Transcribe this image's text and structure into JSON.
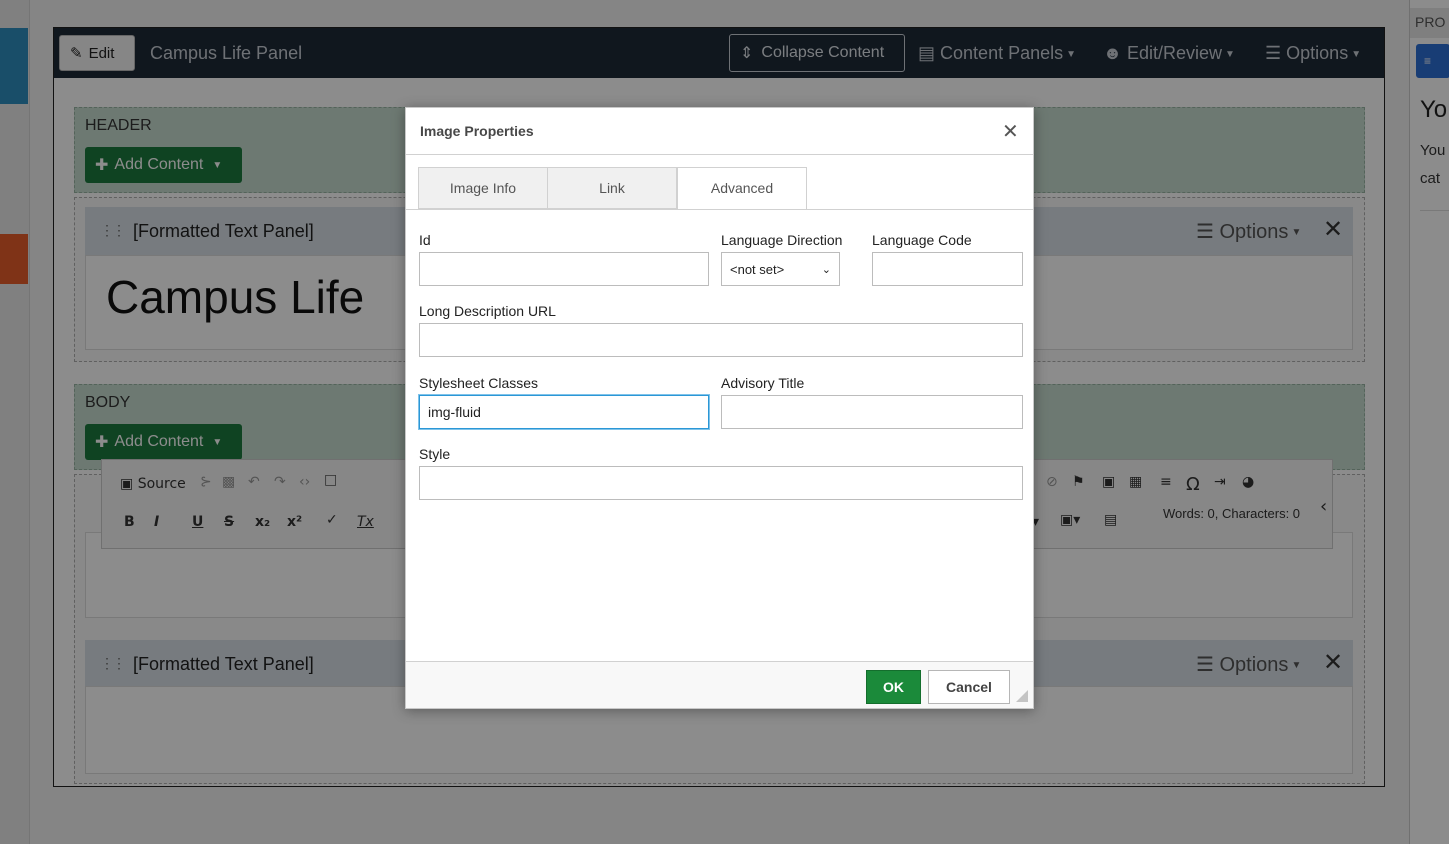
{
  "right_panel": {
    "header_text": "PRO",
    "title_text": "Yo",
    "text_line1": "You",
    "text_line2": "cat"
  },
  "topbar": {
    "edit_label": "Edit",
    "panel_name": "Campus Life Panel",
    "collapse_label": "Collapse Content",
    "content_panels_label": "Content Panels",
    "edit_review_label": "Edit/Review",
    "options_label": "Options"
  },
  "regions": {
    "header_label": "HEADER",
    "body_label": "BODY",
    "add_content_label": "Add Content"
  },
  "panels": {
    "formatted_text_label": "[Formatted Text Panel]",
    "options_label": "Options",
    "big_text": "Campus Life"
  },
  "rte": {
    "source_label": "Source",
    "bold": "B",
    "italic": "I",
    "underline": "U",
    "strike": "S",
    "subscript": "x₂",
    "superscript": "x²",
    "clear_format": "Tx",
    "word_count": "Words: 0, Characters: 0"
  },
  "dialog": {
    "title": "Image Properties",
    "tabs": [
      {
        "label": "Image Info"
      },
      {
        "label": "Link"
      },
      {
        "label": "Advanced"
      }
    ],
    "id_label": "Id",
    "id_value": "",
    "lang_dir_label": "Language Direction",
    "lang_dir_value": "<not set>",
    "lang_code_label": "Language Code",
    "lang_code_value": "",
    "long_desc_label": "Long Description URL",
    "long_desc_value": "",
    "classes_label": "Stylesheet Classes",
    "classes_value": "img-fluid",
    "advisory_label": "Advisory Title",
    "advisory_value": "",
    "style_label": "Style",
    "style_value": "",
    "ok_label": "OK",
    "cancel_label": "Cancel"
  },
  "colors": {
    "accent_green": "#1b8a3a",
    "topbar_bg": "#1e2a38",
    "focus_blue": "#2b97d6"
  }
}
